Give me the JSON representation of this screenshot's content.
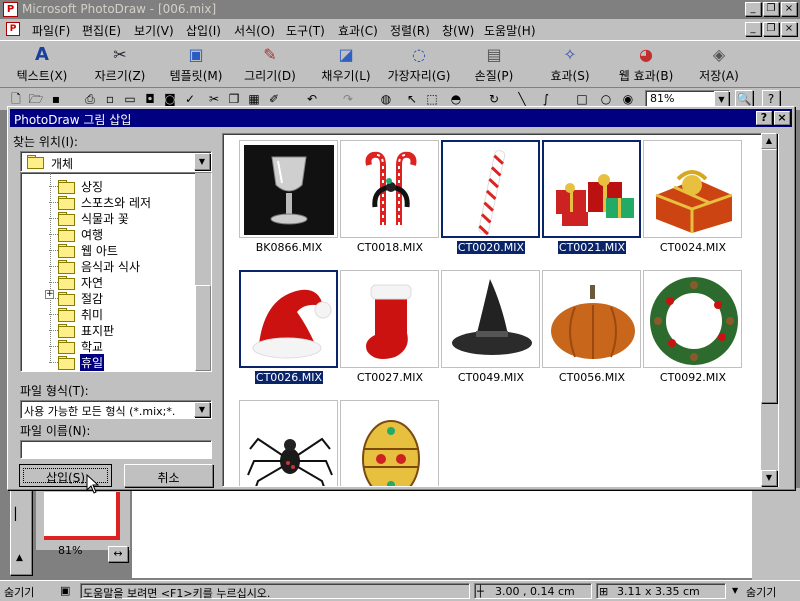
{
  "app": {
    "title": "Microsoft PhotoDraw - [006.mix]",
    "title_buttons": [
      "_",
      "❐",
      "×"
    ]
  },
  "menu": {
    "items": [
      "파일(F)",
      "편집(E)",
      "보기(V)",
      "삽입(I)",
      "서식(O)",
      "도구(T)",
      "효과(C)",
      "정렬(R)",
      "창(W)",
      "도움말(H)"
    ],
    "doc_buttons": [
      "_",
      "❐",
      "×"
    ]
  },
  "big_toolbar": {
    "buttons": [
      {
        "label": "텍스트(X)",
        "icon": "text-a-icon"
      },
      {
        "label": "자르기(Z)",
        "icon": "scissors-icon"
      },
      {
        "label": "템플릿(M)",
        "icon": "template-icon"
      },
      {
        "label": "그리기(D)",
        "icon": "pencil-icon"
      },
      {
        "label": "채우기(L)",
        "icon": "paint-bucket-icon"
      },
      {
        "label": "가장자리(G)",
        "icon": "edge-icon"
      },
      {
        "label": "손질(P)",
        "icon": "touchup-icon"
      },
      {
        "label": "효과(S)",
        "icon": "effects-icon"
      },
      {
        "label": "웹 효과(B)",
        "icon": "web-effects-icon"
      },
      {
        "label": "저장(A)",
        "icon": "save-icon"
      }
    ]
  },
  "standard_toolbar": {
    "zoom": "81%"
  },
  "dialog": {
    "title": "PhotoDraw 그림 삽입",
    "lookin_label": "찾는 위치(I):",
    "lookin_value": "개체",
    "tree_items": [
      {
        "label": "상징",
        "selected": false
      },
      {
        "label": "스포츠와 레저",
        "selected": false
      },
      {
        "label": "식물과 꽃",
        "selected": false
      },
      {
        "label": "여행",
        "selected": false
      },
      {
        "label": "웹 아트",
        "selected": false
      },
      {
        "label": "음식과 식사",
        "selected": false
      },
      {
        "label": "자연",
        "selected": false
      },
      {
        "label": "절감",
        "selected": false,
        "expandable": true
      },
      {
        "label": "취미",
        "selected": false
      },
      {
        "label": "표지판",
        "selected": false
      },
      {
        "label": "학교",
        "selected": false
      },
      {
        "label": "휴일",
        "selected": true
      }
    ],
    "filetype_label": "파일 형식(T):",
    "filetype_value": "사용 가능한 모든 형식 (*.mix;*.",
    "filename_label": "파일 이름(N):",
    "filename_value": "",
    "insert_button": "삽입(S)",
    "cancel_button": "취소",
    "items": [
      {
        "name": "BK0866.MIX",
        "selected": false,
        "picture": "silver-goblet"
      },
      {
        "name": "CT0018.MIX",
        "selected": false,
        "picture": "candy-canes-with-bow"
      },
      {
        "name": "CT0020.MIX",
        "selected": true,
        "picture": "candy-cane"
      },
      {
        "name": "CT0021.MIX",
        "selected": true,
        "picture": "gift-boxes"
      },
      {
        "name": "CT0024.MIX",
        "selected": false,
        "picture": "gift-box-gold-bow"
      },
      {
        "name": "CT0026.MIX",
        "selected": true,
        "picture": "santa-hat"
      },
      {
        "name": "CT0027.MIX",
        "selected": false,
        "picture": "christmas-stocking"
      },
      {
        "name": "CT0049.MIX",
        "selected": false,
        "picture": "witch-hat"
      },
      {
        "name": "CT0056.MIX",
        "selected": false,
        "picture": "pumpkin"
      },
      {
        "name": "CT0092.MIX",
        "selected": false,
        "picture": "christmas-wreath"
      },
      {
        "name": "",
        "selected": false,
        "picture": "spider"
      },
      {
        "name": "",
        "selected": false,
        "picture": "decorated-egg"
      }
    ]
  },
  "thumbnail_panel": {
    "zoom": "81%"
  },
  "status": {
    "hide_left": "숨기기",
    "help_text": "도움말을 보려면 <F1>키를 누르십시오.",
    "position": "3.00 , 0.14  cm",
    "size": "3.11 x 3.35  cm",
    "hide_right": "숨기기"
  }
}
